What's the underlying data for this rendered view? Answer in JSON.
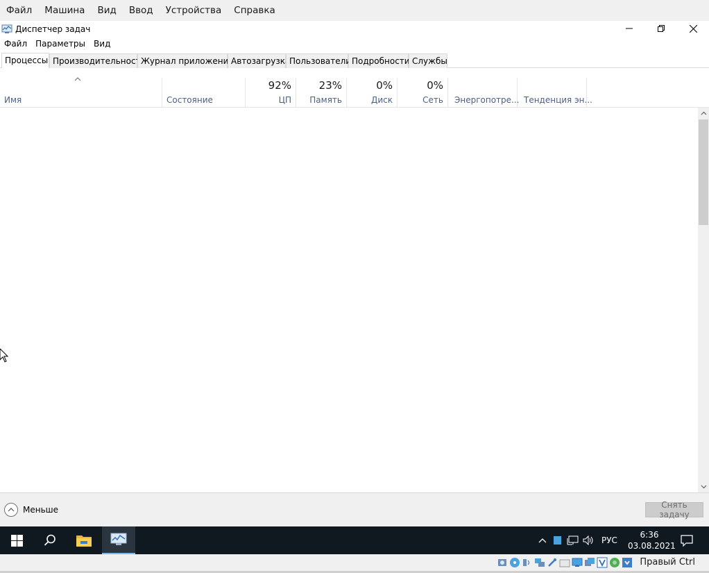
{
  "vbox_menu": [
    "Файл",
    "Машина",
    "Вид",
    "Ввод",
    "Устройства",
    "Справка"
  ],
  "window": {
    "title": "Диспетчер задач"
  },
  "tm_menu": [
    "Файл",
    "Параметры",
    "Вид"
  ],
  "tabs": [
    {
      "label": "Процессы",
      "active": true
    },
    {
      "label": "Производительность",
      "active": false
    },
    {
      "label": "Журнал приложений",
      "active": false
    },
    {
      "label": "Автозагрузка",
      "active": false
    },
    {
      "label": "Пользователи",
      "active": false
    },
    {
      "label": "Подробности",
      "active": false
    },
    {
      "label": "Службы",
      "active": false
    }
  ],
  "columns": {
    "name": {
      "label": "Имя"
    },
    "status": {
      "label": "Состояние"
    },
    "cpu": {
      "label": "ЦП",
      "value": "92%"
    },
    "memory": {
      "label": "Память",
      "value": "23%"
    },
    "disk": {
      "label": "Диск",
      "value": "0%"
    },
    "network": {
      "label": "Сеть",
      "value": "0%"
    },
    "power": {
      "label": "Энергопотре..."
    },
    "power_trend": {
      "label": "Тенденция эн..."
    }
  },
  "footer": {
    "less_label": "Меньше",
    "end_task_label": "Снять задачу"
  },
  "taskbar": {
    "language": "РУС",
    "time": "6:36",
    "date": "03.08.2021"
  },
  "vbox_status": {
    "host_key": "Правый Ctrl"
  },
  "colors": {
    "taskbar_bg": "#101820",
    "header_label": "#4d6082",
    "accent": "#76b9ed"
  }
}
